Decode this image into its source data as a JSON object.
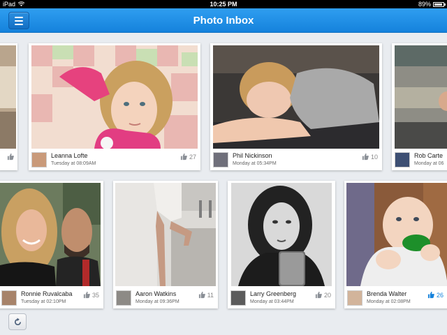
{
  "status": {
    "device": "iPad",
    "time": "10:25 PM",
    "battery": "89%"
  },
  "navbar": {
    "title": "Photo Inbox"
  },
  "colors": {
    "accent": "#1582dc",
    "background": "#e9ecf0"
  },
  "icons": {
    "menu": "hamburger-icon",
    "like": "thumbs-up-icon",
    "refresh": "refresh-icon",
    "wifi": "wifi-icon",
    "battery": "battery-icon"
  },
  "cards": [
    {
      "name": "",
      "time": "",
      "likes": ""
    },
    {
      "name": "Leanna Lofte",
      "time": "Tuesday at 08:09AM",
      "likes": "27"
    },
    {
      "name": "Phil Nickinson",
      "time": "Monday at 05:34PM",
      "likes": "10"
    },
    {
      "name": "Rob Carte",
      "time": "Monday at 06",
      "likes": ""
    },
    {
      "name": "Ronnie Ruvalcaba",
      "time": "Tuesday at 02:10PM",
      "likes": "35"
    },
    {
      "name": "Aaron Watkins",
      "time": "Monday at 09:36PM",
      "likes": "11"
    },
    {
      "name": "Larry Greenberg",
      "time": "Monday at 03:44PM",
      "likes": "20"
    },
    {
      "name": "Brenda Walter",
      "time": "Monday at 02:08PM",
      "likes": "26"
    }
  ]
}
